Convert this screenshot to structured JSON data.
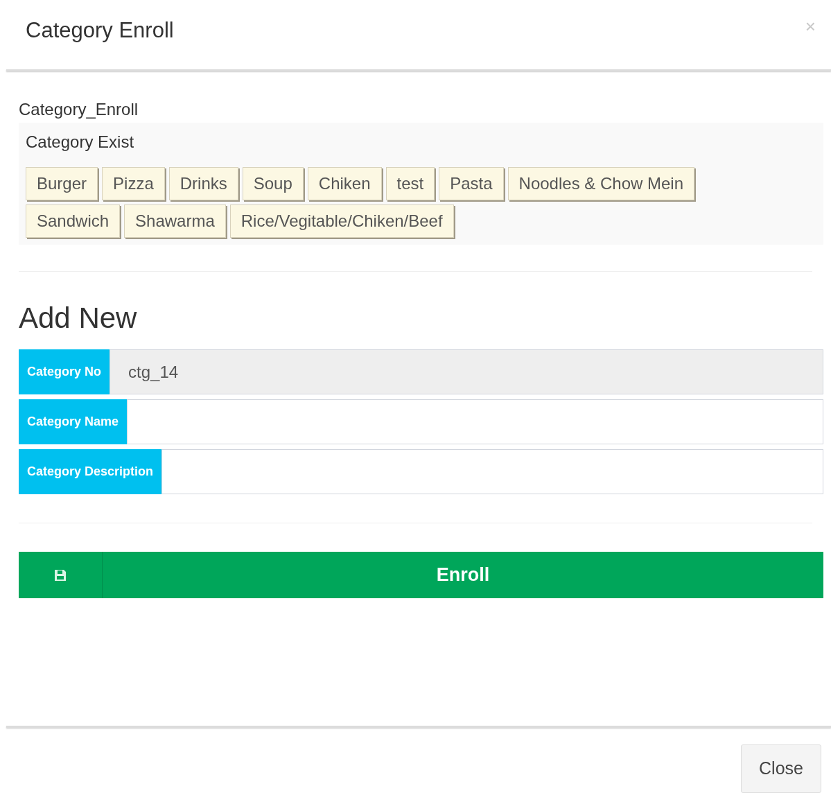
{
  "dialog": {
    "title": "Category Enroll",
    "close_icon": "×"
  },
  "section_label": "Category_Enroll",
  "existing": {
    "heading": "Category Exist",
    "tags": [
      "Burger",
      "Pizza",
      "Drinks",
      "Soup",
      "Chiken",
      "test",
      "Pasta",
      "Noodles & Chow Mein",
      "Sandwich",
      "Shawarma",
      "Rice/Vegitable/Chiken/Beef"
    ]
  },
  "add_new": {
    "heading": "Add New",
    "fields": [
      {
        "label": "Category No",
        "value": "ctg_14",
        "disabled": true
      },
      {
        "label": "Category Name",
        "disabled": false
      },
      {
        "label": "Category Description",
        "disabled": false
      }
    ],
    "submit": "Enroll"
  },
  "footer": {
    "button": "Close"
  }
}
